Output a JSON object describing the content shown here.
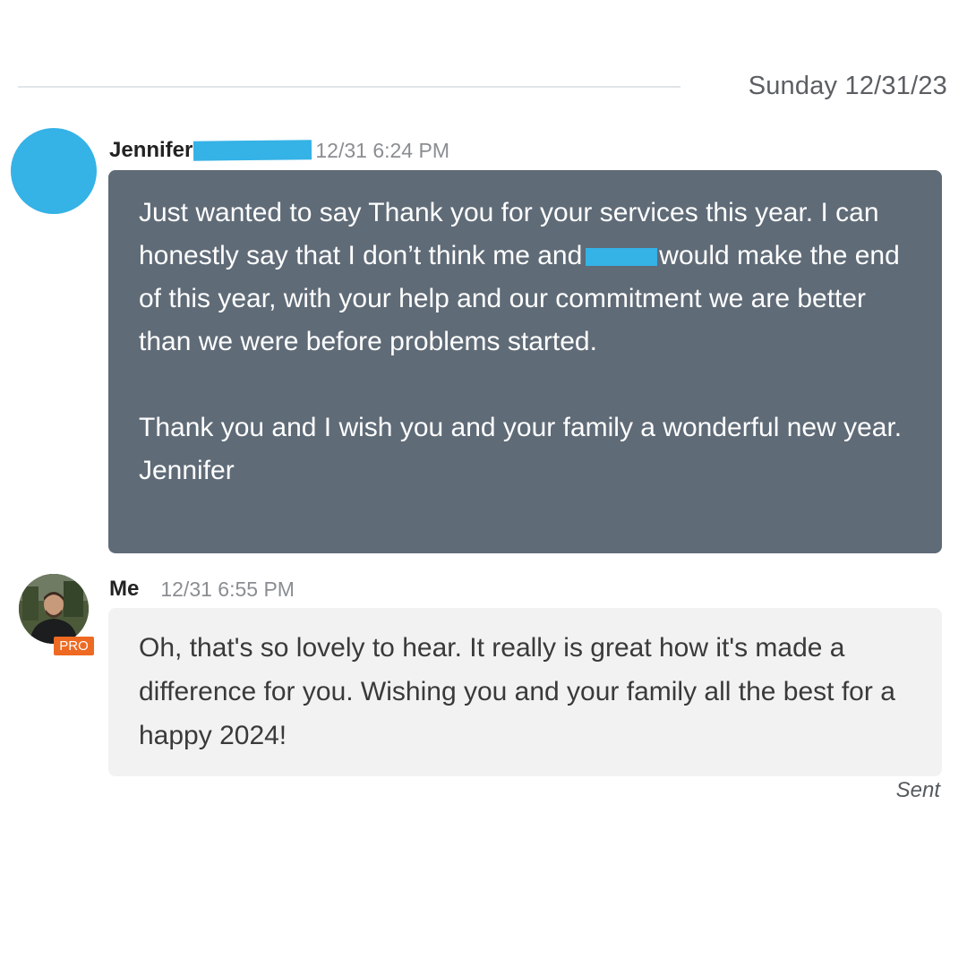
{
  "thread": {
    "date_label": "Sunday 12/31/23"
  },
  "incoming": {
    "sender_name": "Jennifer",
    "time": "12/31 6:24 PM",
    "avatar_color": "#35b2e6",
    "paragraph1_part1": "Just wanted to say Thank you for your services this year. I can honestly say that I don’t think me and",
    "paragraph1_part2": "would make the end of this year, with your help and our commitment we are better than we were before problems started.",
    "paragraph2": "Thank you and I wish you and your family a wonderful new year. Jennifer",
    "bubble_color": "#5f6b77"
  },
  "outgoing": {
    "sender_name": "Me",
    "time": "12/31 6:55 PM",
    "badge": "PRO",
    "badge_color": "#ee6a23",
    "text": "Oh, that's so lovely to hear. It really is great how it's made a difference for you. Wishing you and your family all the best for a happy 2024!",
    "status": "Sent",
    "bubble_color": "#f2f2f3"
  },
  "redaction_color": "#35b2e6"
}
